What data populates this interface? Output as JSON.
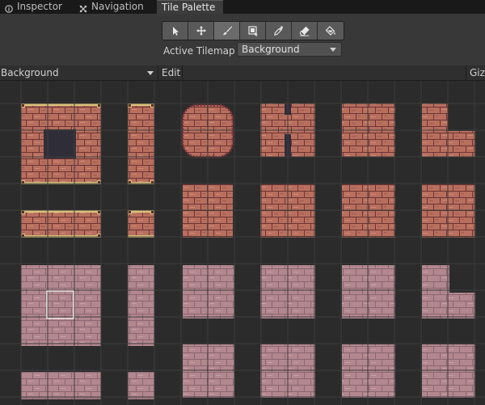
{
  "tabs": [
    {
      "label": "Inspector",
      "icon": "info-icon",
      "active": false
    },
    {
      "label": "Navigation",
      "icon": "navigation-icon",
      "active": false
    },
    {
      "label": "Tile Palette",
      "icon": "",
      "active": true
    }
  ],
  "tools": [
    {
      "name": "select-tool",
      "icon": "arrow-pointer-icon",
      "selected": false
    },
    {
      "name": "move-tool",
      "icon": "move-arrows-icon",
      "selected": false
    },
    {
      "name": "paint-tool",
      "icon": "brush-icon",
      "selected": true
    },
    {
      "name": "box-fill-tool",
      "icon": "box-fill-icon",
      "selected": false
    },
    {
      "name": "picker-tool",
      "icon": "eyedropper-icon",
      "selected": false
    },
    {
      "name": "erase-tool",
      "icon": "eraser-icon",
      "selected": false
    },
    {
      "name": "flood-fill-tool",
      "icon": "paint-bucket-icon",
      "selected": false
    }
  ],
  "active_tilemap": {
    "label": "Active Tilemap",
    "value": "Background"
  },
  "palette": {
    "value": "Background",
    "edit_label": "Edit",
    "gizmos_label": "Gizm"
  },
  "colors": {
    "brick": "#b86f5e",
    "brick_dark": "#5b2a2c",
    "brick_light": "#d28b78",
    "gold": "#d9c27a",
    "pink_brick": "#b38891",
    "pink_dark": "#7a5964",
    "void": "#2f2e38",
    "selection": "#ffffff"
  }
}
